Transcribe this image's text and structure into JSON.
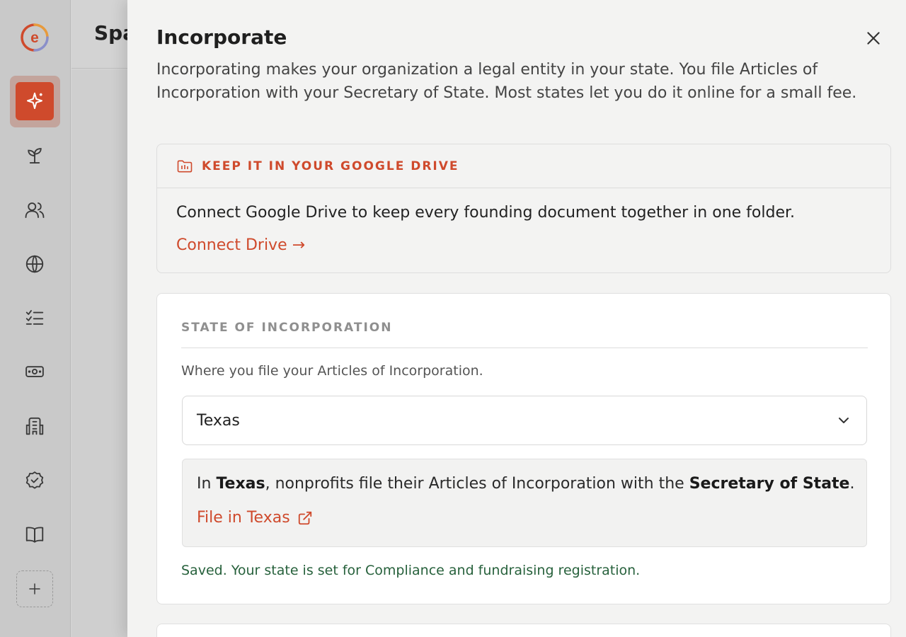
{
  "background": {
    "title": "Spa"
  },
  "sidebar": {
    "logo_letter": "e",
    "items": [
      {
        "name": "sparkle",
        "active": true
      },
      {
        "name": "sprout"
      },
      {
        "name": "people"
      },
      {
        "name": "globe"
      },
      {
        "name": "checklist"
      },
      {
        "name": "money"
      },
      {
        "name": "building"
      },
      {
        "name": "badge-check"
      },
      {
        "name": "book"
      },
      {
        "name": "plus"
      }
    ]
  },
  "drawer": {
    "title": "Incorporate",
    "description": "Incorporating makes your organization a legal entity in your state. You file Articles of Incorporation with your Secretary of State. Most states let you do it online for a small fee.",
    "drive_card": {
      "heading": "KEEP IT IN YOUR GOOGLE DRIVE",
      "text": "Connect Google Drive to keep every founding document together in one folder.",
      "link": "Connect Drive →"
    },
    "state_card": {
      "label": "STATE OF INCORPORATION",
      "help": "Where you file your Articles of Incorporation.",
      "selected_state": "Texas",
      "info": {
        "prefix": "In ",
        "state": "Texas",
        "middle": ", nonprofits file their Articles of Incorporation with the ",
        "office": "Secretary of State",
        "suffix": "."
      },
      "file_link": "File in Texas",
      "saved_message": "Saved. Your state is set for Compliance and fundraising registration."
    }
  },
  "colors": {
    "accent": "#cf4a2c",
    "success": "#27613c"
  }
}
